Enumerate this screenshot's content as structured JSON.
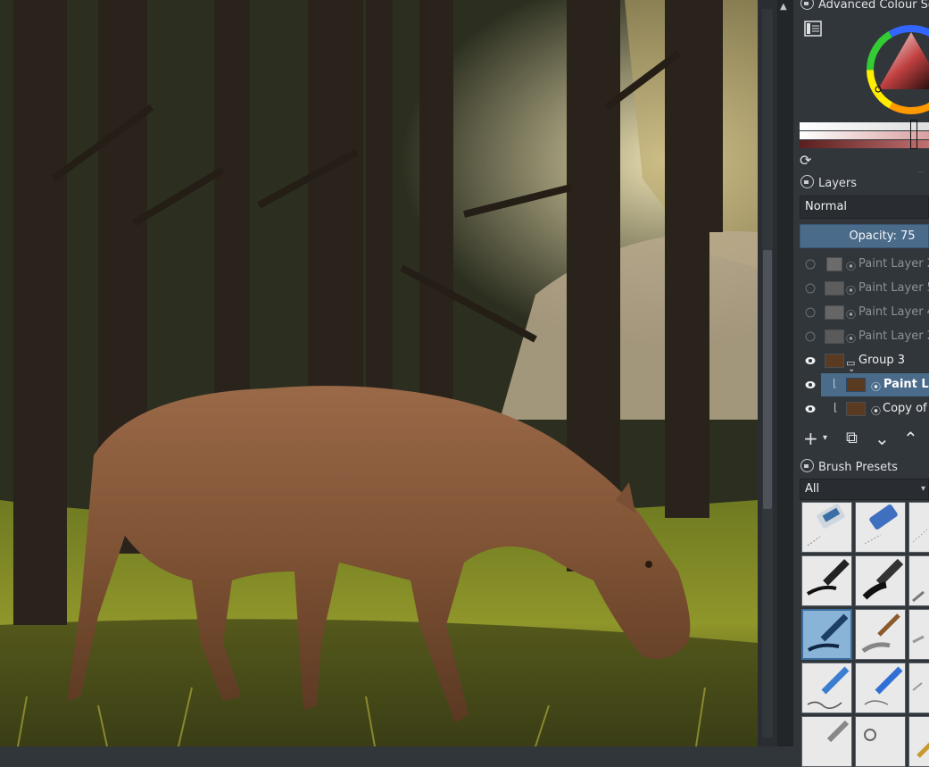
{
  "dockers": {
    "colour_selector": {
      "title": "Advanced Colour Se"
    },
    "layers": {
      "title": "Layers",
      "blend_mode": "Normal",
      "opacity_label": "Opacity:",
      "opacity_value": "75",
      "items": [
        {
          "name": "Paint Layer 2",
          "visible": false
        },
        {
          "name": "Paint Layer 5",
          "visible": false
        },
        {
          "name": "Paint Layer 4",
          "visible": false
        },
        {
          "name": "Paint Layer 2",
          "visible": false
        },
        {
          "name": "Group 3",
          "visible": true
        },
        {
          "name": "Paint La",
          "visible": true,
          "selected": true
        },
        {
          "name": "Copy of",
          "visible": true
        }
      ]
    },
    "brush_presets": {
      "title": "Brush Presets",
      "filter": "All"
    }
  },
  "colors": {
    "ui_background": "#31363b",
    "selection": "#4b6b8b",
    "selected_preset": "#8ab3d8"
  },
  "icons": {
    "add_layer": "plus-icon",
    "duplicate_layer": "duplicate-icon",
    "move_down": "chevron-down-icon",
    "move_up": "chevron-up-icon",
    "visible": "eye-icon",
    "hidden": "eye-closed-icon"
  }
}
